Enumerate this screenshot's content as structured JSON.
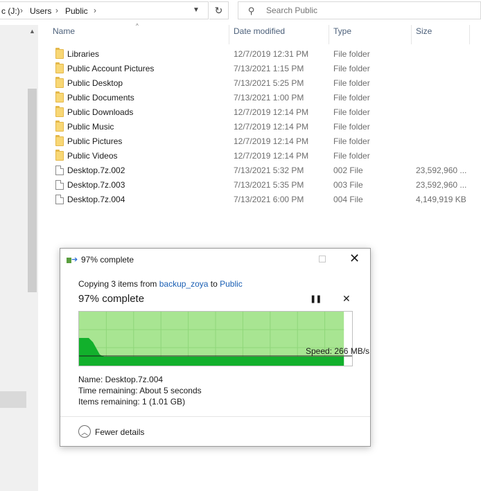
{
  "address": {
    "drive": "c (J:)",
    "breadcrumbs": [
      "Users",
      "Public"
    ],
    "search_placeholder": "Search Public"
  },
  "columns": {
    "name": "Name",
    "date": "Date modified",
    "type": "Type",
    "size": "Size"
  },
  "files": [
    {
      "name": "Libraries",
      "date": "12/7/2019 12:31 PM",
      "type": "File folder",
      "size": "",
      "icon": "folder-icon"
    },
    {
      "name": "Public Account Pictures",
      "date": "7/13/2021 1:15 PM",
      "type": "File folder",
      "size": "",
      "icon": "folder-icon"
    },
    {
      "name": "Public Desktop",
      "date": "7/13/2021 5:25 PM",
      "type": "File folder",
      "size": "",
      "icon": "folder-icon"
    },
    {
      "name": "Public Documents",
      "date": "7/13/2021 1:00 PM",
      "type": "File folder",
      "size": "",
      "icon": "folder-icon"
    },
    {
      "name": "Public Downloads",
      "date": "12/7/2019 12:14 PM",
      "type": "File folder",
      "size": "",
      "icon": "folder-icon"
    },
    {
      "name": "Public Music",
      "date": "12/7/2019 12:14 PM",
      "type": "File folder",
      "size": "",
      "icon": "folder-icon"
    },
    {
      "name": "Public Pictures",
      "date": "12/7/2019 12:14 PM",
      "type": "File folder",
      "size": "",
      "icon": "folder-icon"
    },
    {
      "name": "Public Videos",
      "date": "12/7/2019 12:14 PM",
      "type": "File folder",
      "size": "",
      "icon": "folder-icon"
    },
    {
      "name": "Desktop.7z.002",
      "date": "7/13/2021 5:32 PM",
      "type": "002 File",
      "size": "23,592,960 ...",
      "icon": "file-icon"
    },
    {
      "name": "Desktop.7z.003",
      "date": "7/13/2021 5:35 PM",
      "type": "003 File",
      "size": "23,592,960 ...",
      "icon": "file-icon"
    },
    {
      "name": "Desktop.7z.004",
      "date": "7/13/2021 6:00 PM",
      "type": "004 File",
      "size": "4,149,919 KB",
      "icon": "file-icon"
    }
  ],
  "dialog": {
    "title": "97% complete",
    "copying_prefix": "Copying 3 items from ",
    "source": "backup_zoya",
    "to_word": " to ",
    "destination": "Public",
    "percent_label": "97% complete",
    "progress_fraction": 0.97,
    "speed_label": "Speed: 266 MB/s",
    "name_label": "Name:  Desktop.7z.004",
    "time_label": "Time remaining:  About 5 seconds",
    "items_label": "Items remaining:  1 (1.01 GB)",
    "fewer_details": "Fewer details",
    "colors": {
      "graph_fill": "#a8e592",
      "graph_speed": "#12b02c",
      "link": "#1a5fb4"
    }
  }
}
